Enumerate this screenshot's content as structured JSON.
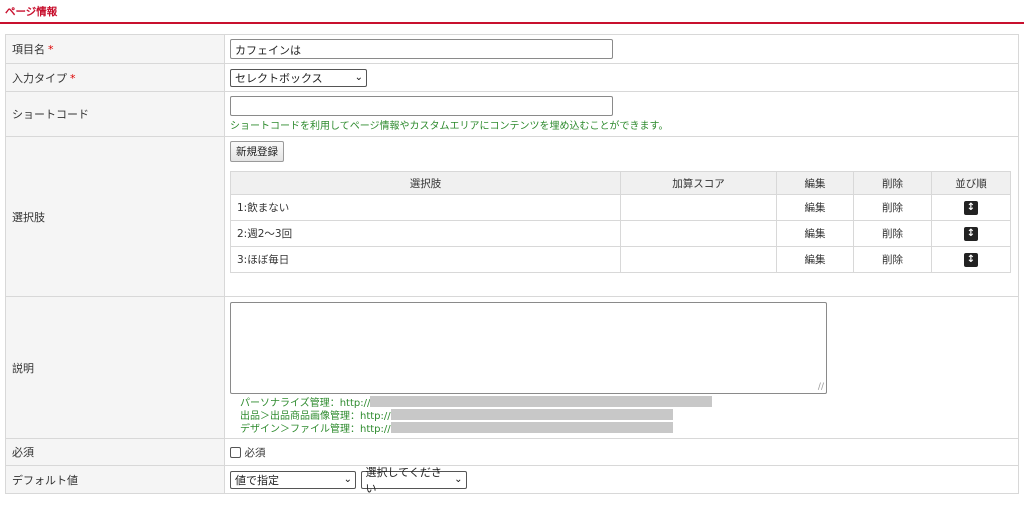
{
  "section": {
    "title": "ページ情報"
  },
  "fields": {
    "item_name": {
      "label": "項目名",
      "required_mark": "*",
      "value": "カフェインは"
    },
    "input_type": {
      "label": "入力タイプ",
      "required_mark": "*",
      "value": "セレクトボックス"
    },
    "shortcode": {
      "label": "ショートコード",
      "value": "",
      "help": "ショートコードを利用してページ情報やカスタムエリアにコンテンツを埋め込むことができます。"
    },
    "choices": {
      "label": "選択肢",
      "new_button": "新規登録",
      "headers": {
        "choice": "選択肢",
        "score": "加算スコア",
        "edit": "編集",
        "delete": "削除",
        "order": "並び順"
      },
      "rows": [
        {
          "label": "1:飲まない",
          "score": "",
          "edit": "編集",
          "delete": "削除"
        },
        {
          "label": "2:週2～3回",
          "score": "",
          "edit": "編集",
          "delete": "削除"
        },
        {
          "label": "3:ほぼ毎日",
          "score": "",
          "edit": "編集",
          "delete": "削除"
        }
      ]
    },
    "description": {
      "label": "説明",
      "value": "",
      "links": [
        "パーソナライズ管理：http://",
        "出品＞出品商品画像管理：http://",
        "デザイン＞ファイル管理：http://"
      ]
    },
    "required": {
      "label": "必須",
      "checkbox_label": "必須",
      "checked": false
    },
    "default_value": {
      "label": "デフォルト値",
      "mode_value": "値で指定",
      "value_placeholder": "選択してください"
    }
  },
  "colors": {
    "accent": "#c8102e",
    "help_text": "#2e8b2e",
    "required": "#dd0000",
    "label_bg": "#f5f5f5"
  }
}
